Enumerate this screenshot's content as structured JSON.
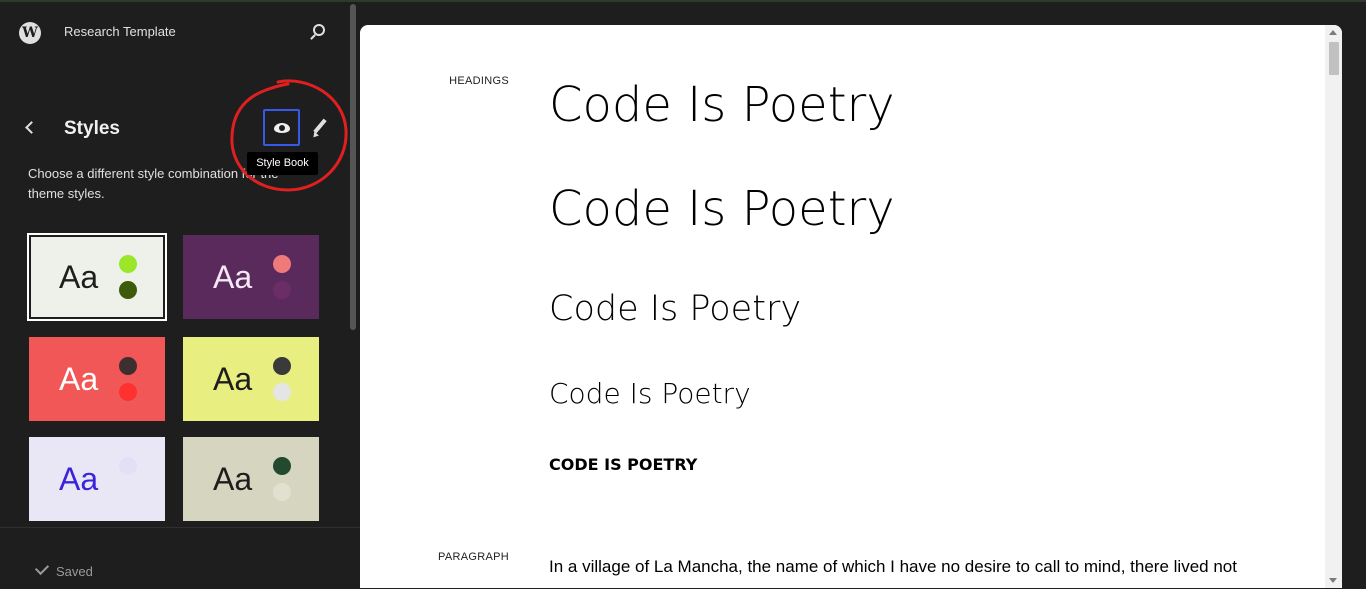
{
  "header": {
    "site_title": "Research Template",
    "logo_icon": "wordpress-logo-icon",
    "search_icon": "search-icon"
  },
  "panel": {
    "title": "Styles",
    "back_icon": "chevron-left-icon",
    "stylebook_icon": "eye-icon",
    "edit_icon": "pencil-icon",
    "tooltip": "Style Book",
    "description": "Choose a different style combination for the theme styles."
  },
  "variations": [
    {
      "label": "Aa",
      "bg": "#eef0ea",
      "text": "#1e1e1e",
      "dot1": "#9ae62a",
      "dot2": "#3d5b0b",
      "selected": true
    },
    {
      "label": "Aa",
      "bg": "#5a2a5c",
      "text": "#f3e8f3",
      "dot1": "#f07a7a",
      "dot2": "#6b2d66",
      "selected": false
    },
    {
      "label": "Aa",
      "bg": "#f25757",
      "text": "#ffffff",
      "dot1": "#3d2f2f",
      "dot2": "#ff3030",
      "selected": false
    },
    {
      "label": "Aa",
      "bg": "#e8ee80",
      "text": "#1e1e1e",
      "dot1": "#3a3a3a",
      "dot2": "#e5e5e5",
      "selected": false
    },
    {
      "label": "Aa",
      "bg": "#e9e7f6",
      "text": "#3b23d9",
      "dot1": "#e3e0f5",
      "dot2": "#e9e7f6",
      "selected": false
    },
    {
      "label": "Aa",
      "bg": "#d6d6c0",
      "text": "#1e1e1e",
      "dot1": "#234a2f",
      "dot2": "#e2e1cf",
      "selected": false
    }
  ],
  "footer": {
    "saved_label": "Saved",
    "check_icon": "check-icon"
  },
  "canvas": {
    "headings_label": "HEADINGS",
    "h1": "Code Is Poetry",
    "h2": "Code Is Poetry",
    "h3": "Code Is Poetry",
    "h4": "Code Is Poetry",
    "h5": "CODE IS POETRY",
    "paragraph_label": "PARAGRAPH",
    "paragraph": "In a village of La Mancha, the name of which I have no desire to call to mind, there lived not"
  },
  "colors": {
    "sidebar_bg": "#1e1e1e",
    "accent": "#3858e9",
    "annotation": "#e02020"
  }
}
